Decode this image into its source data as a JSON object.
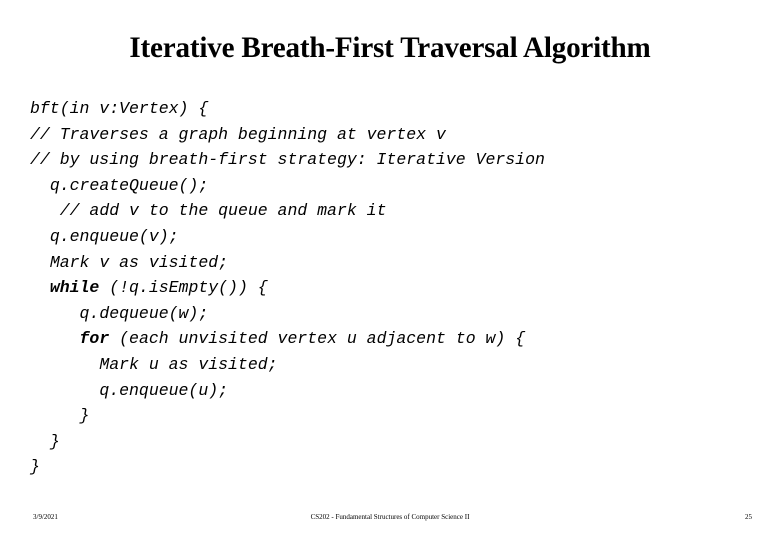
{
  "slide": {
    "title": "Iterative Breath-First Traversal Algorithm",
    "background_color": "#ffffff",
    "text_color": "#000000"
  },
  "code": {
    "lines": [
      {
        "indent": "",
        "pre": "",
        "keyword": "",
        "post": "bft(in v:Vertex) {"
      },
      {
        "indent": "",
        "pre": "",
        "keyword": "",
        "post": "// Traverses a graph beginning at vertex v"
      },
      {
        "indent": "",
        "pre": "",
        "keyword": "",
        "post": "// by using breath-first strategy: Iterative Version"
      },
      {
        "indent": "  ",
        "pre": "",
        "keyword": "",
        "post": "q.createQueue();"
      },
      {
        "indent": "   ",
        "pre": "",
        "keyword": "",
        "post": "// add v to the queue and mark it"
      },
      {
        "indent": "  ",
        "pre": "",
        "keyword": "",
        "post": "q.enqueue(v);"
      },
      {
        "indent": "  ",
        "pre": "",
        "keyword": "",
        "post": "Mark v as visited;"
      },
      {
        "indent": "  ",
        "pre": "",
        "keyword": "while",
        "post": " (!q.isEmpty()) {"
      },
      {
        "indent": "     ",
        "pre": "",
        "keyword": "",
        "post": "q.dequeue(w);"
      },
      {
        "indent": "     ",
        "pre": "",
        "keyword": "for",
        "post": " (each unvisited vertex u adjacent to w) {"
      },
      {
        "indent": "       ",
        "pre": "",
        "keyword": "",
        "post": "Mark u as visited;"
      },
      {
        "indent": "       ",
        "pre": "",
        "keyword": "",
        "post": "q.enqueue(u);"
      },
      {
        "indent": "     ",
        "pre": "",
        "keyword": "",
        "post": "}"
      },
      {
        "indent": "  ",
        "pre": "",
        "keyword": "",
        "post": "}"
      },
      {
        "indent": "",
        "pre": "",
        "keyword": "",
        "post": "}"
      }
    ]
  },
  "footer": {
    "date": "3/9/2021",
    "course": "CS202 - Fundamental Structures of Computer Science II",
    "page_number": "25"
  }
}
